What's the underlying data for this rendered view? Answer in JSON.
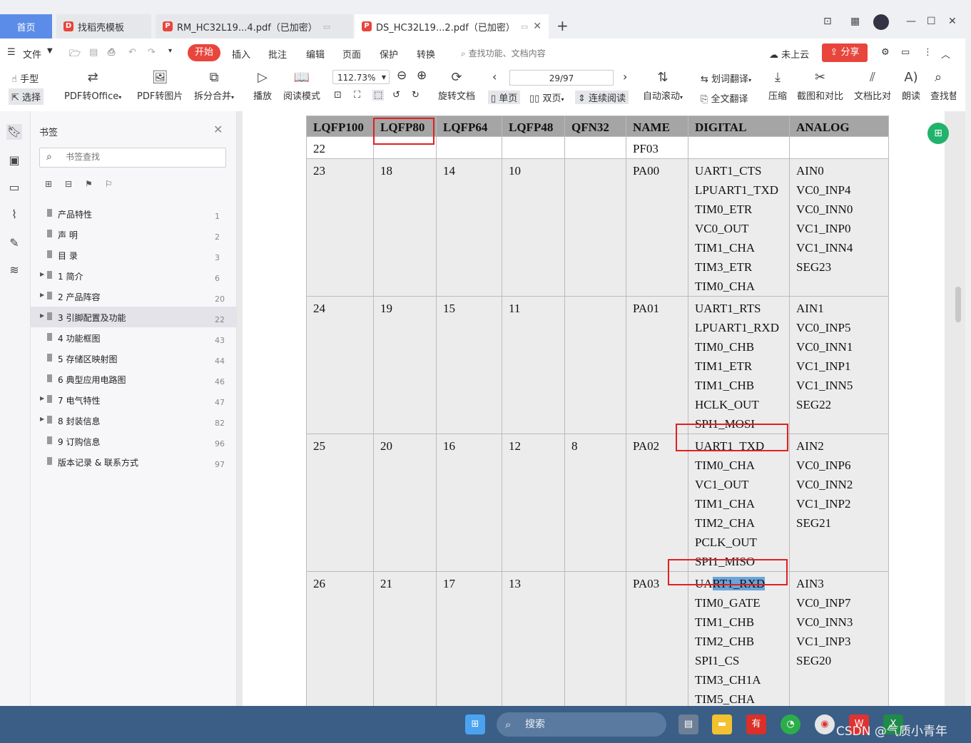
{
  "tabs": {
    "home": "首页",
    "t1": "找稻壳模板",
    "t2": "RM_HC32L19...4.pdf（已加密）",
    "t3": "DS_HC32L19...2.pdf（已加密）"
  },
  "menu": {
    "file": "文件",
    "start": "开始",
    "insert": "插入",
    "annotate": "批注",
    "edit": "编辑",
    "page": "页面",
    "protect": "保护",
    "convert": "转换",
    "search_hint": "查找功能、文档内容",
    "cloud": "未上云",
    "share": "分享"
  },
  "toolbar": {
    "hand": "手型",
    "select": "选择",
    "pdf_to_office": "PDF转Office",
    "pdf_to_image": "PDF转图片",
    "split_merge": "拆分合并",
    "play": "播放",
    "read_mode": "阅读模式",
    "zoom": "112.73%",
    "rotate_doc": "旋转文档",
    "single": "单页",
    "double": "双页",
    "continuous": "连续阅读",
    "page_indicator": "29/97",
    "auto_scroll": "自动滚动",
    "word_translate": "划词翻译",
    "full_translate": "全文翻译",
    "compress": "压缩",
    "screenshot": "截图和对比",
    "compare": "文档比对",
    "read_aloud": "朗读",
    "find": "查找替"
  },
  "bookmarks": {
    "title": "书签",
    "search_placeholder": "书签查找",
    "items": [
      {
        "label": "产品特性",
        "page": "1",
        "expandable": false
      },
      {
        "label": "声 明",
        "page": "2",
        "expandable": false
      },
      {
        "label": "目 录",
        "page": "3",
        "expandable": false
      },
      {
        "label": "1 简介",
        "page": "6",
        "expandable": true
      },
      {
        "label": "2 产品阵容",
        "page": "20",
        "expandable": true
      },
      {
        "label": "3 引脚配置及功能",
        "page": "22",
        "expandable": true
      },
      {
        "label": "4 功能框图",
        "page": "43",
        "expandable": false
      },
      {
        "label": "5 存储区映射图",
        "page": "44",
        "expandable": false
      },
      {
        "label": "6 典型应用电路图",
        "page": "46",
        "expandable": false
      },
      {
        "label": "7 电气特性",
        "page": "47",
        "expandable": true
      },
      {
        "label": "8 封装信息",
        "page": "82",
        "expandable": true
      },
      {
        "label": "9 订购信息",
        "page": "96",
        "expandable": false
      },
      {
        "label": "版本记录 & 联系方式",
        "page": "97",
        "expandable": false
      }
    ]
  },
  "pin_table": {
    "headers": [
      "LQFP100",
      "LQFP80",
      "LQFP64",
      "LQFP48",
      "QFN32",
      "NAME",
      "DIGITAL",
      "ANALOG"
    ],
    "rows": [
      {
        "lqfp100": "22",
        "lqfp80": "",
        "lqfp64": "",
        "lqfp48": "",
        "qfn32": "",
        "name": "PF03",
        "digital": [],
        "analog": []
      },
      {
        "lqfp100": "23",
        "lqfp80": "18",
        "lqfp64": "14",
        "lqfp48": "10",
        "qfn32": "",
        "name": "PA00",
        "digital": [
          "UART1_CTS",
          "LPUART1_TXD",
          "TIM0_ETR",
          "VC0_OUT",
          "TIM1_CHA",
          "TIM3_ETR",
          "TIM0_CHA"
        ],
        "analog": [
          "AIN0",
          "VC0_INP4",
          "VC0_INN0",
          "VC1_INP0",
          "VC1_INN4",
          "SEG23"
        ]
      },
      {
        "lqfp100": "24",
        "lqfp80": "19",
        "lqfp64": "15",
        "lqfp48": "11",
        "qfn32": "",
        "name": "PA01",
        "digital": [
          "UART1_RTS",
          "LPUART1_RXD",
          "TIM0_CHB",
          "TIM1_ETR",
          "TIM1_CHB",
          "HCLK_OUT",
          "SPI1_MOSI"
        ],
        "analog": [
          "AIN1",
          "VC0_INP5",
          "VC0_INN1",
          "VC1_INP1",
          "VC1_INN5",
          "SEG22"
        ]
      },
      {
        "lqfp100": "25",
        "lqfp80": "20",
        "lqfp64": "16",
        "lqfp48": "12",
        "qfn32": "8",
        "name": "PA02",
        "digital": [
          "UART1_TXD",
          "TIM0_CHA",
          "VC1_OUT",
          "TIM1_CHA",
          "TIM2_CHA",
          "PCLK_OUT",
          "SPI1_MISO"
        ],
        "analog": [
          "AIN2",
          "VC0_INP6",
          "VC0_INN2",
          "VC1_INP2",
          "SEG21"
        ]
      },
      {
        "lqfp100": "26",
        "lqfp80": "21",
        "lqfp64": "17",
        "lqfp48": "13",
        "qfn32": "",
        "name": "PA03",
        "digital": [
          "UART1_RXD",
          "TIM0_GATE",
          "TIM1_CHB",
          "TIM2_CHB",
          "SPI1_CS",
          "TIM3_CH1A",
          "TIM5_CHA"
        ],
        "analog": [
          "AIN3",
          "VC0_INP7",
          "VC0_INN3",
          "VC1_INP3",
          "SEG20"
        ]
      }
    ],
    "selected_text_prefix": "UA",
    "selected_text": "RT1_RXD"
  },
  "taskbar": {
    "search": "搜索",
    "watermark": "CSDN @气质小青年"
  },
  "colors": {
    "accent": "#e8453c",
    "home_tab": "#5b8ce8",
    "table_header": "#a5a5a5",
    "highlight_box": "#e02020",
    "taskbar": "#3a5e86"
  }
}
